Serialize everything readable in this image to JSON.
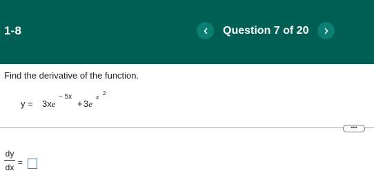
{
  "header": {
    "section": "1-8",
    "question_counter": "Question 7 of 20",
    "prev_icon": "chevron-left-icon",
    "next_icon": "chevron-right-icon",
    "background_color": "#005f55",
    "button_color": "#0b7e73"
  },
  "question": {
    "prompt": "Find the derivative of the function.",
    "equation": {
      "lhs": "y = ",
      "term1_coeff": "3x",
      "term1_base": "e",
      "term1_exponent": "− 5x",
      "plus": "+",
      "term2_coeff": "3",
      "term2_base": "e",
      "term2_exponent_base": "x",
      "term2_exponent_power": "2"
    }
  },
  "more_button": {
    "label": "•••"
  },
  "answer": {
    "numerator": "dy",
    "denominator": "dx",
    "equals": "=",
    "value": ""
  }
}
